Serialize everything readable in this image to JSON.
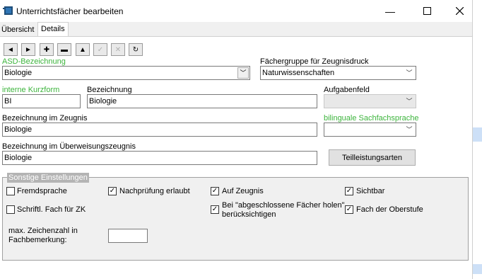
{
  "window": {
    "title": "Unterrichtsfächer bearbeiten",
    "minimize_icon": "minimize-icon",
    "maximize_icon": "maximize-icon",
    "close_icon": "close-icon"
  },
  "tabs": [
    {
      "label": "Übersicht",
      "active": false
    },
    {
      "label": "Details",
      "active": true
    }
  ],
  "toolbar": {
    "icons": [
      "arrow-left-icon",
      "arrow-right-icon",
      "plus-icon",
      "minus-icon",
      "triangle-up-icon",
      "checkmark-icon",
      "cancel-icon",
      "refresh-icon"
    ],
    "glyphs": [
      "◄",
      "►",
      "✚",
      "▬",
      "▲",
      "✓",
      "✕",
      "↻"
    ]
  },
  "form": {
    "asd_label": "ASD-Bezeichnung",
    "asd_value": "Biologie",
    "group_label": "Fächergruppe für Zeugnisdruck",
    "group_value": "Naturwissenschaften",
    "short_label": "interne Kurzform",
    "short_value": "BI",
    "name_label": "Bezeichnung",
    "name_value": "Biologie",
    "task_label": "Aufgabenfeld",
    "task_value": "",
    "report_label": "Bezeichnung im Zeugnis",
    "report_value": "Biologie",
    "bilingual_label": "bilinguale Sachfachsprache",
    "bilingual_value": "",
    "transfer_label": "Bezeichnung im Überweisungszeugnis",
    "transfer_value": "Biologie",
    "partial_button": "Teilleistungsarten"
  },
  "settings": {
    "title": "Sonstige Einstellungen",
    "checkboxes": [
      {
        "label": "Fremdsprache",
        "checked": false
      },
      {
        "label": "Nachprüfung erlaubt",
        "checked": true
      },
      {
        "label": "Auf Zeugnis",
        "checked": true
      },
      {
        "label": "Sichtbar",
        "checked": true
      },
      {
        "label": "Schriftl. Fach für ZK",
        "checked": false
      },
      {
        "label_line1": "Bei \"abgeschlossene Fächer holen\"",
        "label_line2": "berücksichtigen",
        "checked": true
      },
      {
        "label": "Fach der Oberstufe",
        "checked": true
      }
    ],
    "maxchars_label_line1": "max. Zeichenzahl in",
    "maxchars_label_line2": "Fachbemerkung:",
    "maxchars_value": ""
  },
  "colors": {
    "accent_label": "#3cb43c"
  }
}
